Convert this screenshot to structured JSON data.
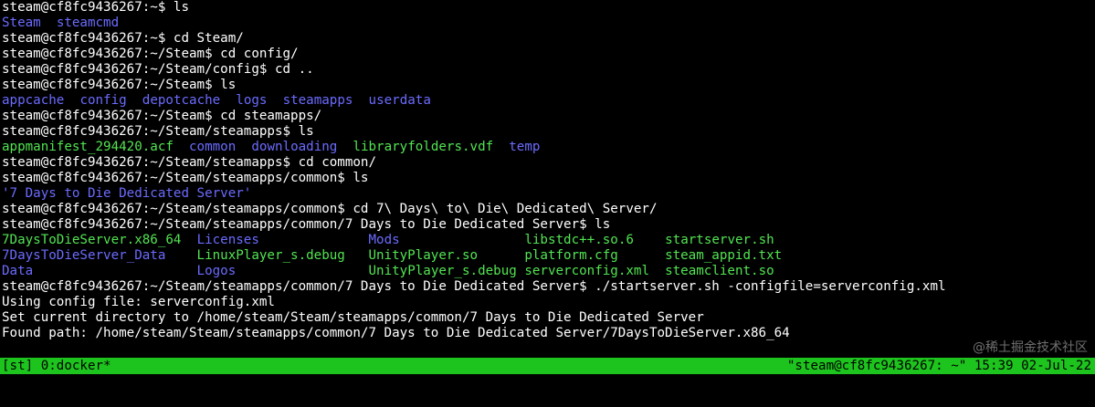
{
  "terminal": {
    "lines": [
      [
        {
          "t": "steam@cf8fc9436267:~$ ls",
          "c": "white"
        }
      ],
      [
        {
          "t": "Steam",
          "c": "blue"
        },
        {
          "t": "  ",
          "c": "white"
        },
        {
          "t": "steamcmd",
          "c": "blue"
        }
      ],
      [
        {
          "t": "steam@cf8fc9436267:~$ cd Steam/",
          "c": "white"
        }
      ],
      [
        {
          "t": "steam@cf8fc9436267:~/Steam$ cd config/",
          "c": "white"
        }
      ],
      [
        {
          "t": "steam@cf8fc9436267:~/Steam/config$ cd ..",
          "c": "white"
        }
      ],
      [
        {
          "t": "steam@cf8fc9436267:~/Steam$ ls",
          "c": "white"
        }
      ],
      [
        {
          "t": "appcache",
          "c": "blue"
        },
        {
          "t": "  ",
          "c": "white"
        },
        {
          "t": "config",
          "c": "blue"
        },
        {
          "t": "  ",
          "c": "white"
        },
        {
          "t": "depotcache",
          "c": "blue"
        },
        {
          "t": "  ",
          "c": "white"
        },
        {
          "t": "logs",
          "c": "blue"
        },
        {
          "t": "  ",
          "c": "white"
        },
        {
          "t": "steamapps",
          "c": "blue"
        },
        {
          "t": "  ",
          "c": "white"
        },
        {
          "t": "userdata",
          "c": "blue"
        }
      ],
      [
        {
          "t": "steam@cf8fc9436267:~/Steam$ cd steamapps/",
          "c": "white"
        }
      ],
      [
        {
          "t": "steam@cf8fc9436267:~/Steam/steamapps$ ls",
          "c": "white"
        }
      ],
      [
        {
          "t": "appmanifest_294420.acf",
          "c": "green"
        },
        {
          "t": "  ",
          "c": "white"
        },
        {
          "t": "common",
          "c": "blue"
        },
        {
          "t": "  ",
          "c": "white"
        },
        {
          "t": "downloading",
          "c": "blue"
        },
        {
          "t": "  ",
          "c": "white"
        },
        {
          "t": "libraryfolders.vdf",
          "c": "green"
        },
        {
          "t": "  ",
          "c": "white"
        },
        {
          "t": "temp",
          "c": "blue"
        }
      ],
      [
        {
          "t": "steam@cf8fc9436267:~/Steam/steamapps$ cd common/",
          "c": "white"
        }
      ],
      [
        {
          "t": "steam@cf8fc9436267:~/Steam/steamapps/common$ ls",
          "c": "white"
        }
      ],
      [
        {
          "t": "'7 Days to Die Dedicated Server'",
          "c": "blue"
        }
      ],
      [
        {
          "t": "steam@cf8fc9436267:~/Steam/steamapps/common$ cd 7\\ Days\\ to\\ Die\\ Dedicated\\ Server/",
          "c": "white"
        }
      ],
      [
        {
          "t": "steam@cf8fc9436267:~/Steam/steamapps/common/7 Days to Die Dedicated Server$ ls",
          "c": "white"
        }
      ],
      [
        {
          "t": "7DaysToDieServer.x86_64",
          "c": "green"
        },
        {
          "t": "  ",
          "c": "white"
        },
        {
          "t": "Licenses",
          "c": "blue"
        },
        {
          "t": "              ",
          "c": "white"
        },
        {
          "t": "Mods",
          "c": "blue"
        },
        {
          "t": "                ",
          "c": "white"
        },
        {
          "t": "libstdc++.so.6",
          "c": "green"
        },
        {
          "t": "    ",
          "c": "white"
        },
        {
          "t": "startserver.sh",
          "c": "green"
        }
      ],
      [
        {
          "t": "7DaysToDieServer_Data",
          "c": "blue"
        },
        {
          "t": "    ",
          "c": "white"
        },
        {
          "t": "LinuxPlayer_s.debug",
          "c": "green"
        },
        {
          "t": "   ",
          "c": "white"
        },
        {
          "t": "UnityPlayer.so",
          "c": "green"
        },
        {
          "t": "      ",
          "c": "white"
        },
        {
          "t": "platform.cfg",
          "c": "green"
        },
        {
          "t": "      ",
          "c": "white"
        },
        {
          "t": "steam_appid.txt",
          "c": "green"
        }
      ],
      [
        {
          "t": "Data",
          "c": "blue"
        },
        {
          "t": "                     ",
          "c": "white"
        },
        {
          "t": "Logos",
          "c": "blue"
        },
        {
          "t": "                 ",
          "c": "white"
        },
        {
          "t": "UnityPlayer_s.debug",
          "c": "green"
        },
        {
          "t": " ",
          "c": "white"
        },
        {
          "t": "serverconfig.xml",
          "c": "green"
        },
        {
          "t": "  ",
          "c": "white"
        },
        {
          "t": "steamclient.so",
          "c": "green"
        }
      ],
      [
        {
          "t": "steam@cf8fc9436267:~/Steam/steamapps/common/7 Days to Die Dedicated Server$ ./startserver.sh -configfile=serverconfig.xml",
          "c": "white"
        }
      ],
      [
        {
          "t": "Using config file: serverconfig.xml",
          "c": "white"
        }
      ],
      [
        {
          "t": "Set current directory to /home/steam/Steam/steamapps/common/7 Days to Die Dedicated Server",
          "c": "white"
        }
      ],
      [
        {
          "t": "Found path: /home/steam/Steam/steamapps/common/7 Days to Die Dedicated Server/7DaysToDieServer.x86_64",
          "c": "white"
        }
      ]
    ]
  },
  "status_bar": {
    "left": "[st] 0:docker*",
    "right": "\"steam@cf8fc9436267: ~\" 15:39 02-Jul-22"
  },
  "watermark": "@稀土掘金技术社区",
  "colors": {
    "background": "#000000",
    "status_bar_bg": "#1ec41e",
    "white": "#ffffff",
    "blue": "#6b6bff",
    "green": "#52e452"
  }
}
